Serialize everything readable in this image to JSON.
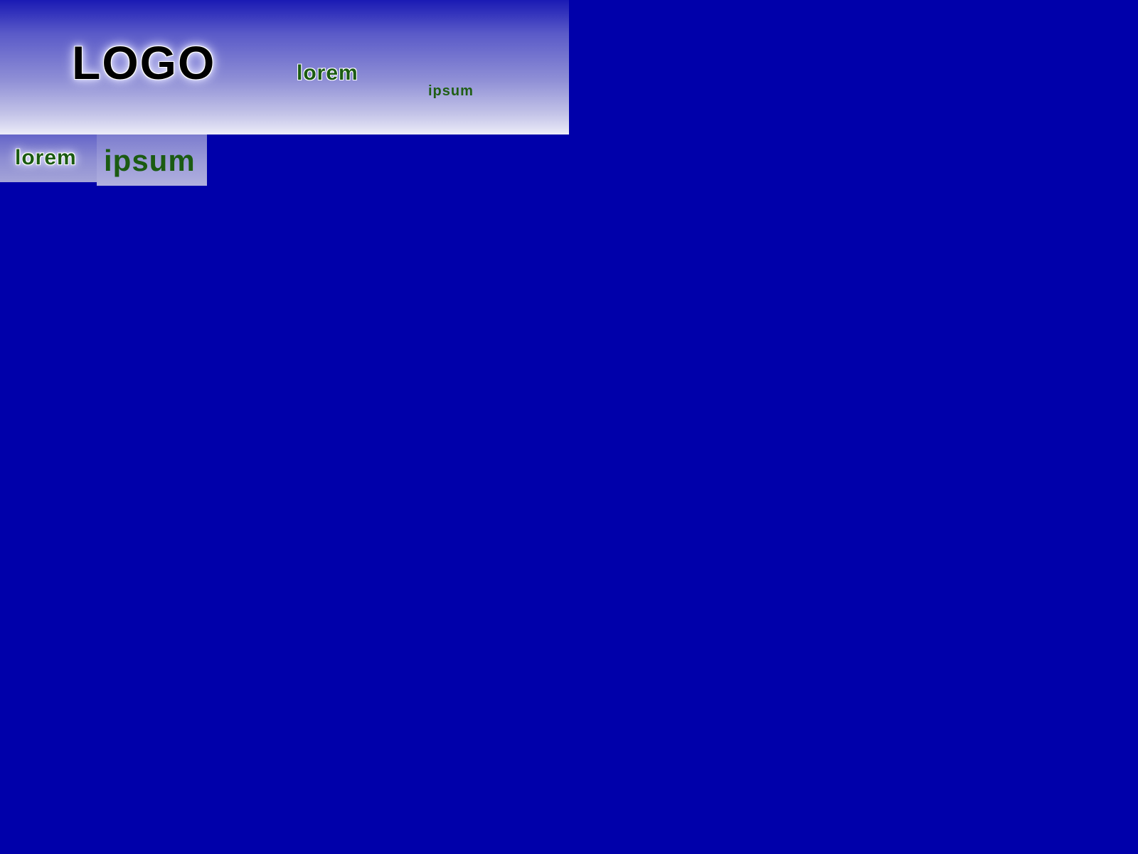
{
  "header": {
    "logo_text": "LOGO",
    "links": [
      {
        "label": "lorem"
      },
      {
        "label": "ipsum"
      }
    ]
  },
  "tabs": [
    {
      "label": "lorem",
      "active": false
    },
    {
      "label": "ipsum",
      "active": true
    }
  ],
  "colors": {
    "page_background": "#0000aa",
    "link_text": "#1b5b12",
    "header_gradient_top": "#1a1ab4",
    "header_gradient_bottom": "#ececf8"
  }
}
